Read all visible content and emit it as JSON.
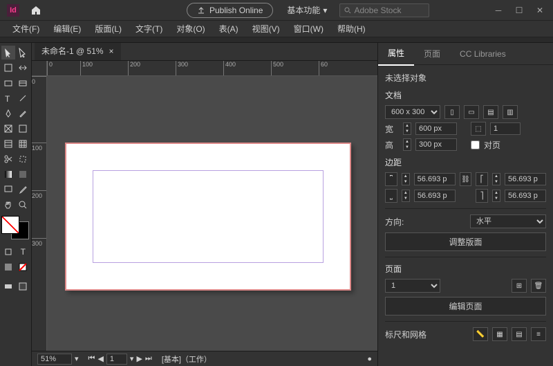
{
  "titlebar": {
    "publish_label": "Publish Online",
    "workspace_label": "基本功能",
    "search_placeholder": "Adobe Stock"
  },
  "menubar": [
    "文件(F)",
    "编辑(E)",
    "版面(L)",
    "文字(T)",
    "对象(O)",
    "表(A)",
    "视图(V)",
    "窗口(W)",
    "帮助(H)"
  ],
  "doc_tab": {
    "label": "未命名-1 @ 51%",
    "close": "×"
  },
  "rulers": {
    "h": [
      "0",
      "100",
      "200",
      "300",
      "400",
      "500",
      "60"
    ],
    "v": [
      "0",
      "100",
      "200",
      "300"
    ]
  },
  "statusbar": {
    "zoom": "51%",
    "page_nav": "1",
    "layer": "[基本]（工作）"
  },
  "panel_tabs": {
    "properties": "属性",
    "pages": "页面",
    "cc": "CC Libraries"
  },
  "properties": {
    "no_selection": "未选择对象",
    "doc_section": "文档",
    "preset": "600 x 300",
    "width_label": "宽",
    "width": "600 px",
    "height_label": "高",
    "height": "300 px",
    "facing_label": "对页",
    "margins_section": "边距",
    "margin_values": [
      "56.693 p",
      "56.693 p",
      "56.693 p",
      "56.693 p"
    ],
    "orientation_section": "方向:",
    "orientation_value": "水平",
    "adjust_layout": "调整版面",
    "scale_label": "1",
    "pages_section": "页面",
    "pages_value": "1",
    "edit_pages": "编辑页面",
    "ruler_grid_section": "标尺和网格"
  }
}
